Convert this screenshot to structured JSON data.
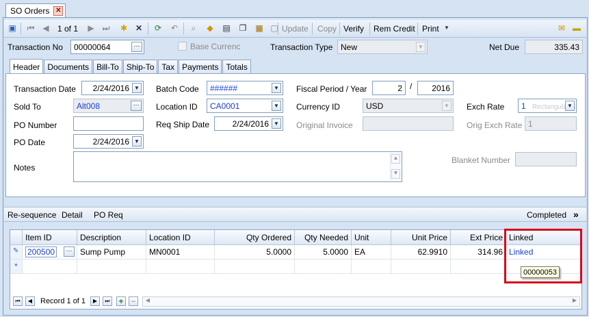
{
  "document_tab": {
    "title": "SO Orders",
    "close": "✕"
  },
  "toolbar": {
    "record": "1 of 1",
    "update": "Update",
    "copy": "Copy",
    "verify": "Verify",
    "rem_credit": "Rem Credit",
    "print": "Print"
  },
  "header": {
    "transaction_no_label": "Transaction No",
    "transaction_no": "00000064",
    "base_currency_label": "Base Currenc",
    "transaction_type_label": "Transaction Type",
    "transaction_type": "New",
    "net_due_label": "Net Due",
    "net_due": "335.43"
  },
  "tabs": [
    "Header",
    "Documents",
    "Bill-To",
    "Ship-To",
    "Tax",
    "Payments",
    "Totals"
  ],
  "form": {
    "transaction_date_label": "Transaction Date",
    "transaction_date": "2/24/2016",
    "sold_to_label": "Sold To",
    "sold_to": "Alt008",
    "po_number_label": "PO Number",
    "po_number": "",
    "po_date_label": "PO Date",
    "po_date": "2/24/2016",
    "notes_label": "Notes",
    "batch_code_label": "Batch Code",
    "batch_code": "######",
    "location_id_label": "Location ID",
    "location_id": "CA0001",
    "req_ship_date_label": "Req Ship Date",
    "req_ship_date": "2/24/2016",
    "fiscal_label": "Fiscal Period / Year",
    "fiscal_period": "2",
    "fiscal_sep": "/",
    "fiscal_year": "2016",
    "currency_id_label": "Currency ID",
    "currency_id": "USD",
    "original_invoice_label": "Original Invoice",
    "exch_rate_label": "Exch Rate",
    "exch_rate": "1",
    "exch_rate_ghost": "Rectangular Sn",
    "orig_exch_rate_label": "Orig Exch Rate",
    "orig_exch_rate": "1",
    "blanket_number_label": "Blanket Number"
  },
  "lines_toolbar": {
    "resequence": "Re-sequence",
    "detail": "Detail",
    "po_req": "PO Req",
    "completed": "Completed",
    "more": "»"
  },
  "grid": {
    "columns": [
      "Item ID",
      "Description",
      "Location ID",
      "Qty Ordered",
      "Qty Needed",
      "Unit",
      "Unit Price",
      "Ext Price",
      "Linked"
    ],
    "rows": [
      {
        "item_id": "200500",
        "description": "Sump Pump",
        "location_id": "MN0001",
        "qty_ordered": "5.0000",
        "qty_needed": "5.0000",
        "unit": "EA",
        "unit_price": "62.9910",
        "ext_price": "314.96",
        "linked": "Linked"
      }
    ],
    "new_row_marker": "*",
    "edit_row_marker": "✎",
    "record": "Record 1 of 1",
    "tooltip": "00000053"
  }
}
